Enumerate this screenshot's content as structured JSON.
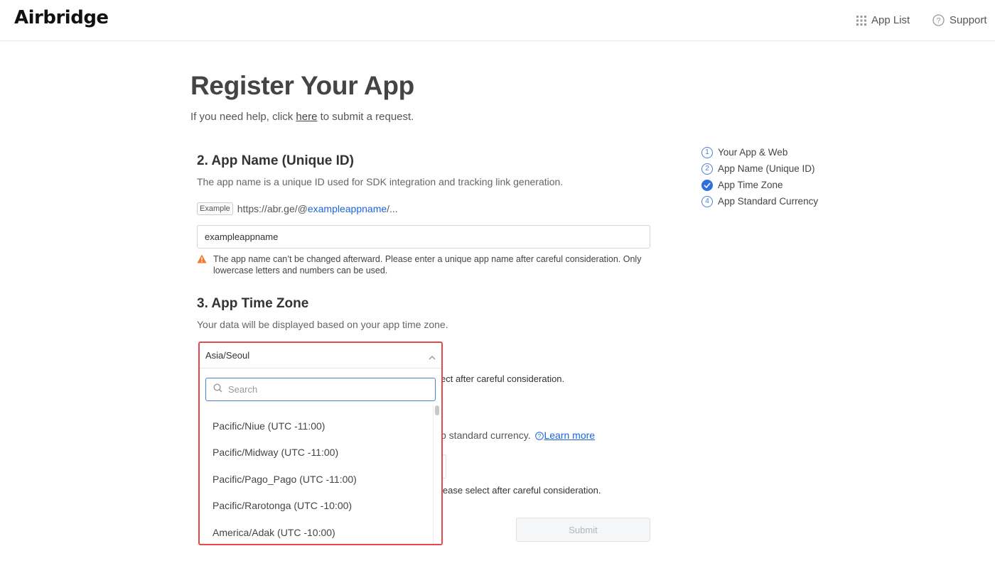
{
  "header": {
    "logo": "Airbridge",
    "app_list": "App List",
    "support": "Support"
  },
  "page": {
    "title": "Register Your App",
    "help_prefix": "If you need help, click ",
    "help_link": "here",
    "help_suffix": " to submit a request."
  },
  "app_name": {
    "title": "2. App Name (Unique ID)",
    "description": "The app name is a unique ID used for SDK integration and tracking link generation.",
    "example_tag": "Example",
    "example_prefix": "https://abr.ge/@",
    "example_name": "exampleappname",
    "example_suffix": "/...",
    "input_value": "exampleappname",
    "warning": "The app name can’t be changed afterward. Please enter a unique app name after careful consideration. Only lowercase letters and numbers can be used."
  },
  "time_zone": {
    "title": "3. App Time Zone",
    "description": "Your data will be displayed based on your app time zone.",
    "selected": "Asia/Seoul",
    "search_placeholder": "Search",
    "options": [
      "Pacific/Niue (UTC -11:00)",
      "Pacific/Midway (UTC -11:00)",
      "Pacific/Pago_Pago (UTC -11:00)",
      "Pacific/Rarotonga (UTC -10:00)",
      "America/Adak (UTC -10:00)"
    ],
    "partial_note": "ect after careful consideration."
  },
  "currency": {
    "partial_desc": "p standard currency.",
    "learn_more": "Learn more",
    "partial_note": "lease select after careful consideration."
  },
  "submit_label": "Submit",
  "steps": [
    {
      "marker": "1",
      "label": "Your App & Web",
      "done": false
    },
    {
      "marker": "2",
      "label": "App Name (Unique ID)",
      "done": false
    },
    {
      "marker": "",
      "label": "App Time Zone",
      "done": true
    },
    {
      "marker": "4",
      "label": "App Standard Currency",
      "done": false
    }
  ],
  "colors": {
    "accent": "#2f6fe0",
    "link": "#1a66d6",
    "highlight_border": "#e5484d",
    "warning": "#f5792a"
  }
}
